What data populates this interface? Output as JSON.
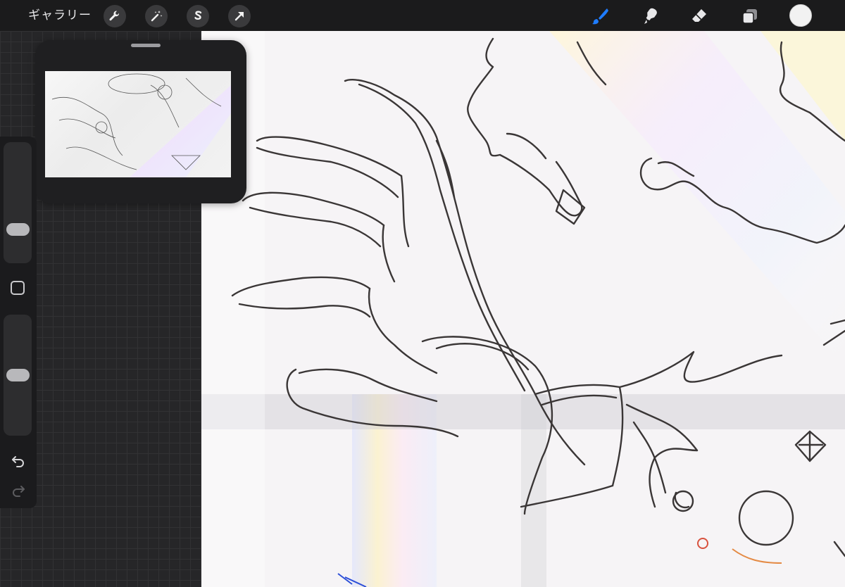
{
  "topbar": {
    "gallery_label": "ギャラリー",
    "left_tools": [
      "wrench-icon",
      "magic-wand-icon",
      "selection-s-icon",
      "transform-arrow-icon"
    ],
    "right_tools": [
      "brush-icon",
      "smudge-icon",
      "eraser-icon",
      "layers-icon"
    ],
    "active_tool": "brush-icon",
    "active_color": "#1e7cff",
    "current_color": "#f2f2f2"
  },
  "sidebar": {
    "brush_size_level": 0.22,
    "opacity_level": 0.5,
    "controls": [
      "modify-square-icon",
      "undo-icon",
      "redo-icon"
    ]
  },
  "reference": {
    "title": ""
  },
  "canvas": {
    "background": "#f6f4f6",
    "stroke_color": "#3a3636"
  }
}
